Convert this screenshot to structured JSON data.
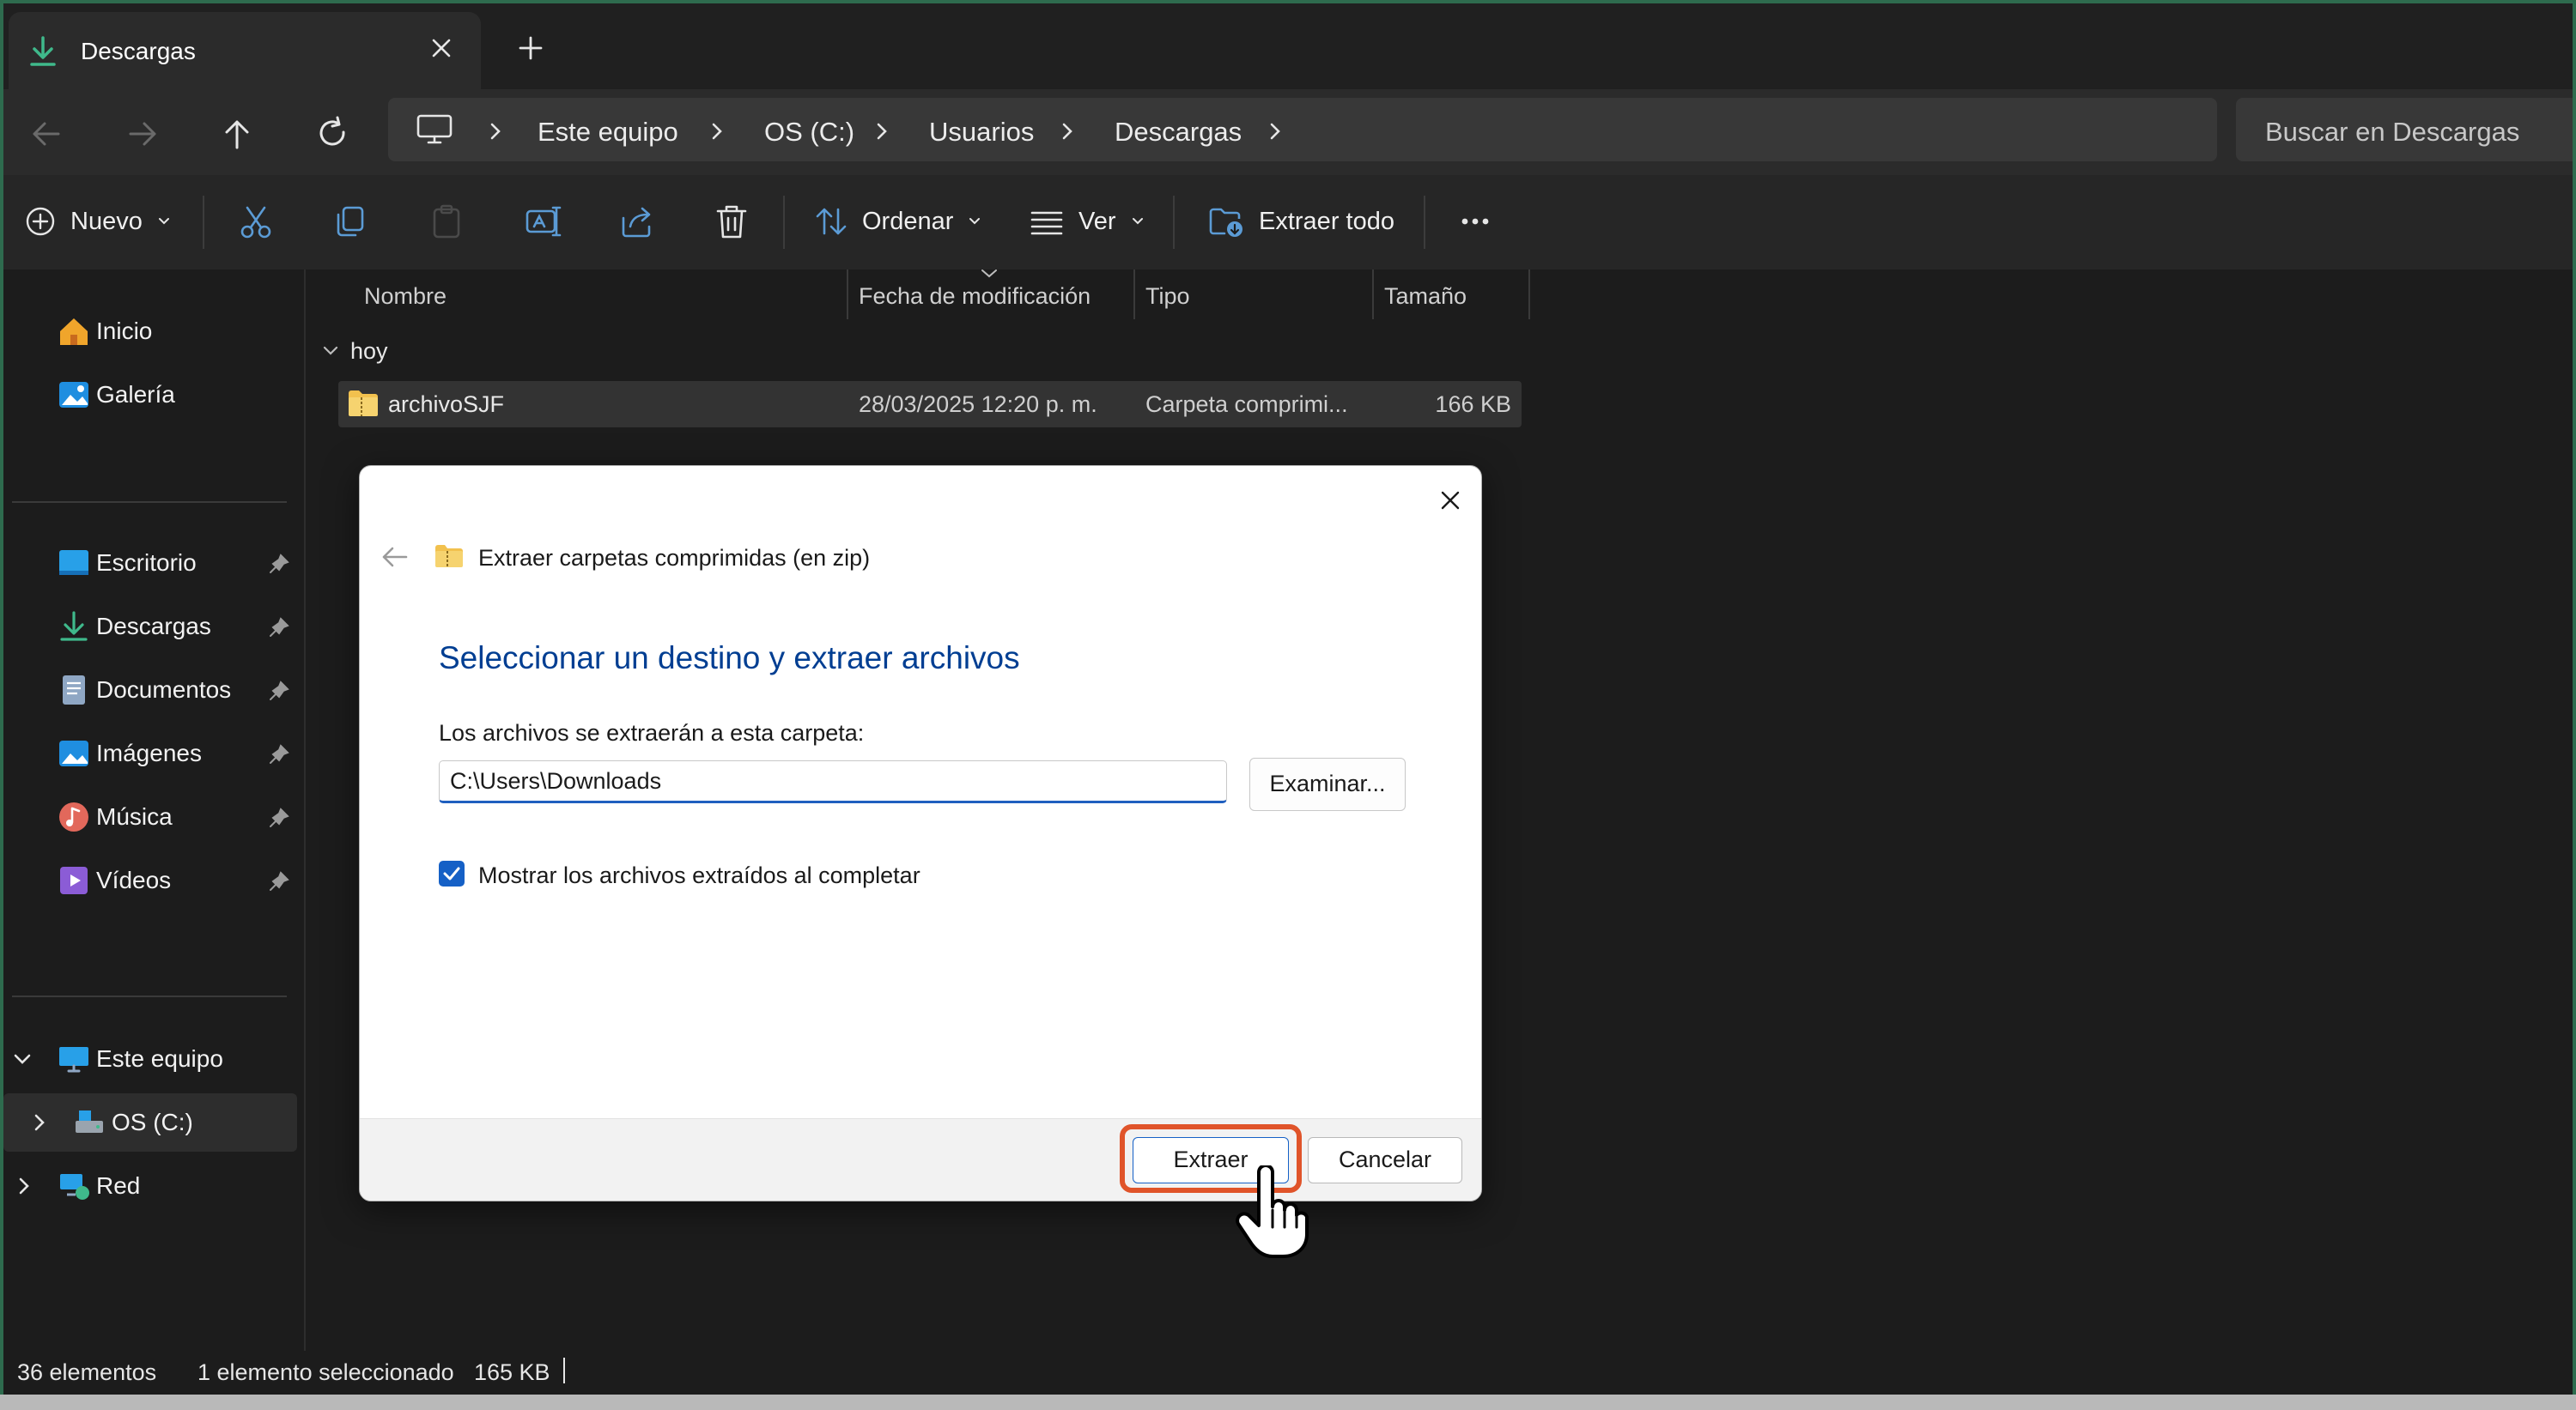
{
  "tab": {
    "title": "Descargas"
  },
  "address": {
    "breadcrumbs": [
      "Este equipo",
      "OS (C:)",
      "Usuarios",
      "Descargas"
    ],
    "search_placeholder": "Buscar en Descargas"
  },
  "toolbar": {
    "new_label": "Nuevo",
    "sort_label": "Ordenar",
    "view_label": "Ver",
    "extract_all_label": "Extraer todo"
  },
  "sidebar": {
    "quick": [
      {
        "label": "Inicio",
        "icon": "home-icon"
      },
      {
        "label": "Galería",
        "icon": "gallery-icon"
      }
    ],
    "pinned": [
      {
        "label": "Escritorio",
        "icon": "desktop-icon"
      },
      {
        "label": "Descargas",
        "icon": "download-icon"
      },
      {
        "label": "Documentos",
        "icon": "documents-icon"
      },
      {
        "label": "Imágenes",
        "icon": "pictures-icon"
      },
      {
        "label": "Música",
        "icon": "music-icon"
      },
      {
        "label": "Vídeos",
        "icon": "videos-icon"
      }
    ],
    "tree": [
      {
        "label": "Este equipo",
        "icon": "computer-icon"
      },
      {
        "label": "OS (C:)",
        "icon": "drive-icon"
      },
      {
        "label": "Red",
        "icon": "network-icon"
      }
    ]
  },
  "list": {
    "columns": [
      "Nombre",
      "Fecha de modificación",
      "Tipo",
      "Tamaño"
    ],
    "group": "hoy",
    "rows": [
      {
        "name": "archivoSJF",
        "modified": "28/03/2025 12:20 p. m.",
        "type": "Carpeta comprimi...",
        "size": "166 KB"
      }
    ]
  },
  "status": {
    "count": "36 elementos",
    "selected": "1 elemento seleccionado",
    "size": "165 KB"
  },
  "dialog": {
    "title": "Extraer carpetas comprimidas (en zip)",
    "heading": "Seleccionar un destino y extraer archivos",
    "folder_label": "Los archivos se extraerán a esta carpeta:",
    "path_value": "C:\\Users\\Downloads",
    "browse_label": "Examinar...",
    "show_files_label": "Mostrar los archivos extraídos al completar",
    "show_files_checked": true,
    "extract_label": "Extraer",
    "cancel_label": "Cancelar"
  },
  "colors": {
    "accent": "#1560c6",
    "heading": "#003e92",
    "highlight": "#e0542a",
    "background": "#1c1c1c"
  }
}
